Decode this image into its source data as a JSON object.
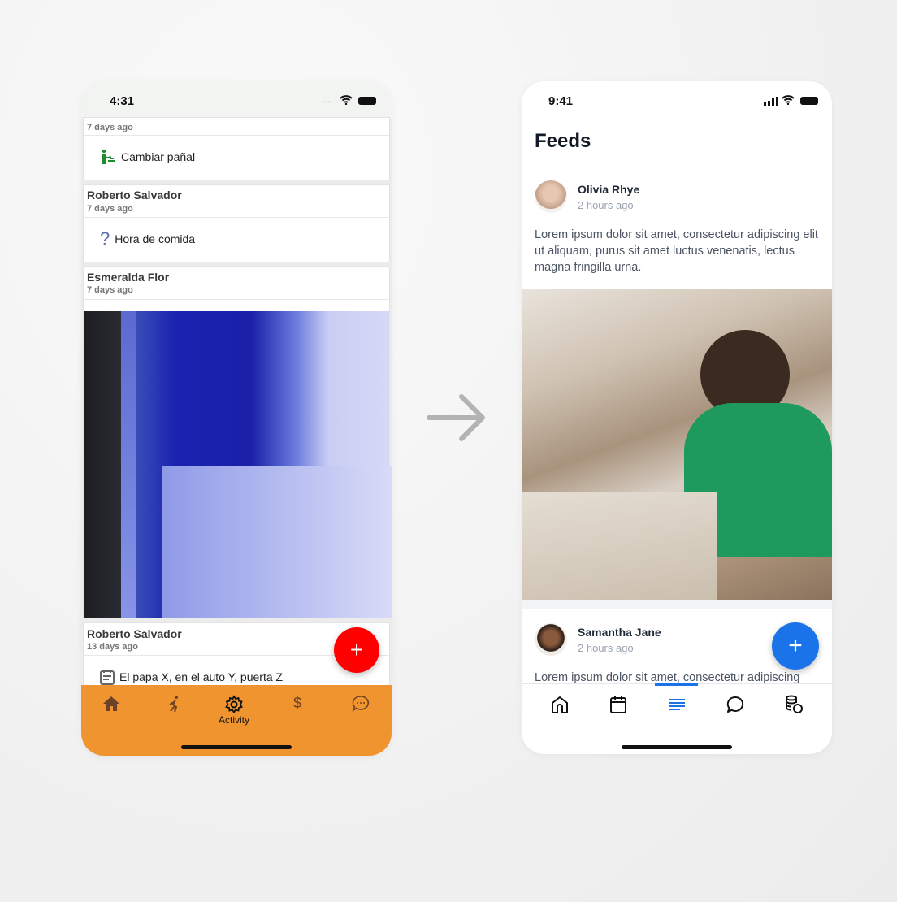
{
  "before": {
    "status_time": "4:31",
    "cards": [
      {
        "date": "7 days ago",
        "activity": "Cambiar pañal",
        "icon": "baby-changing-icon",
        "icon_color": "#1e8c2e"
      },
      {
        "name": "Roberto Salvador",
        "date": "7 days ago",
        "activity": "Hora de comida",
        "icon": "question-icon"
      },
      {
        "name": "Esmeralda Flor",
        "date": "7 days ago",
        "image": "photo of computer screen with code"
      },
      {
        "name": "Roberto Salvador",
        "date": "13 days ago",
        "activity": "El papa X, en el auto Y, puerta Z",
        "icon": "calendar-note-icon"
      }
    ],
    "fab_color": "#ff0000",
    "tabbar_color": "#f0942f",
    "tabs": [
      {
        "icon": "home-icon"
      },
      {
        "icon": "activity-runner-icon"
      },
      {
        "icon": "gear-icon",
        "label": "Activity",
        "active": true
      },
      {
        "icon": "dollar-icon"
      },
      {
        "icon": "chat-icon"
      }
    ]
  },
  "after": {
    "status_time": "9:41",
    "title": "Feeds",
    "posts": [
      {
        "name": "Olivia Rhye",
        "time": "2 hours ago",
        "text": "Lorem ipsum dolor sit amet, consectetur adipiscing elit ut aliquam, purus sit amet luctus venenatis, lectus magna fringilla urna."
      },
      {
        "name": "Samantha Jane",
        "time": "2 hours ago",
        "text": "Lorem ipsum dolor sit amet, consectetur adipiscing"
      }
    ],
    "fab_color": "#1a73e8",
    "accent": "#1a73e8",
    "tabs": [
      {
        "icon": "home-icon"
      },
      {
        "icon": "calendar-icon"
      },
      {
        "icon": "feed-lines-icon",
        "active": true
      },
      {
        "icon": "chat-bubble-icon"
      },
      {
        "icon": "coins-icon"
      }
    ]
  }
}
